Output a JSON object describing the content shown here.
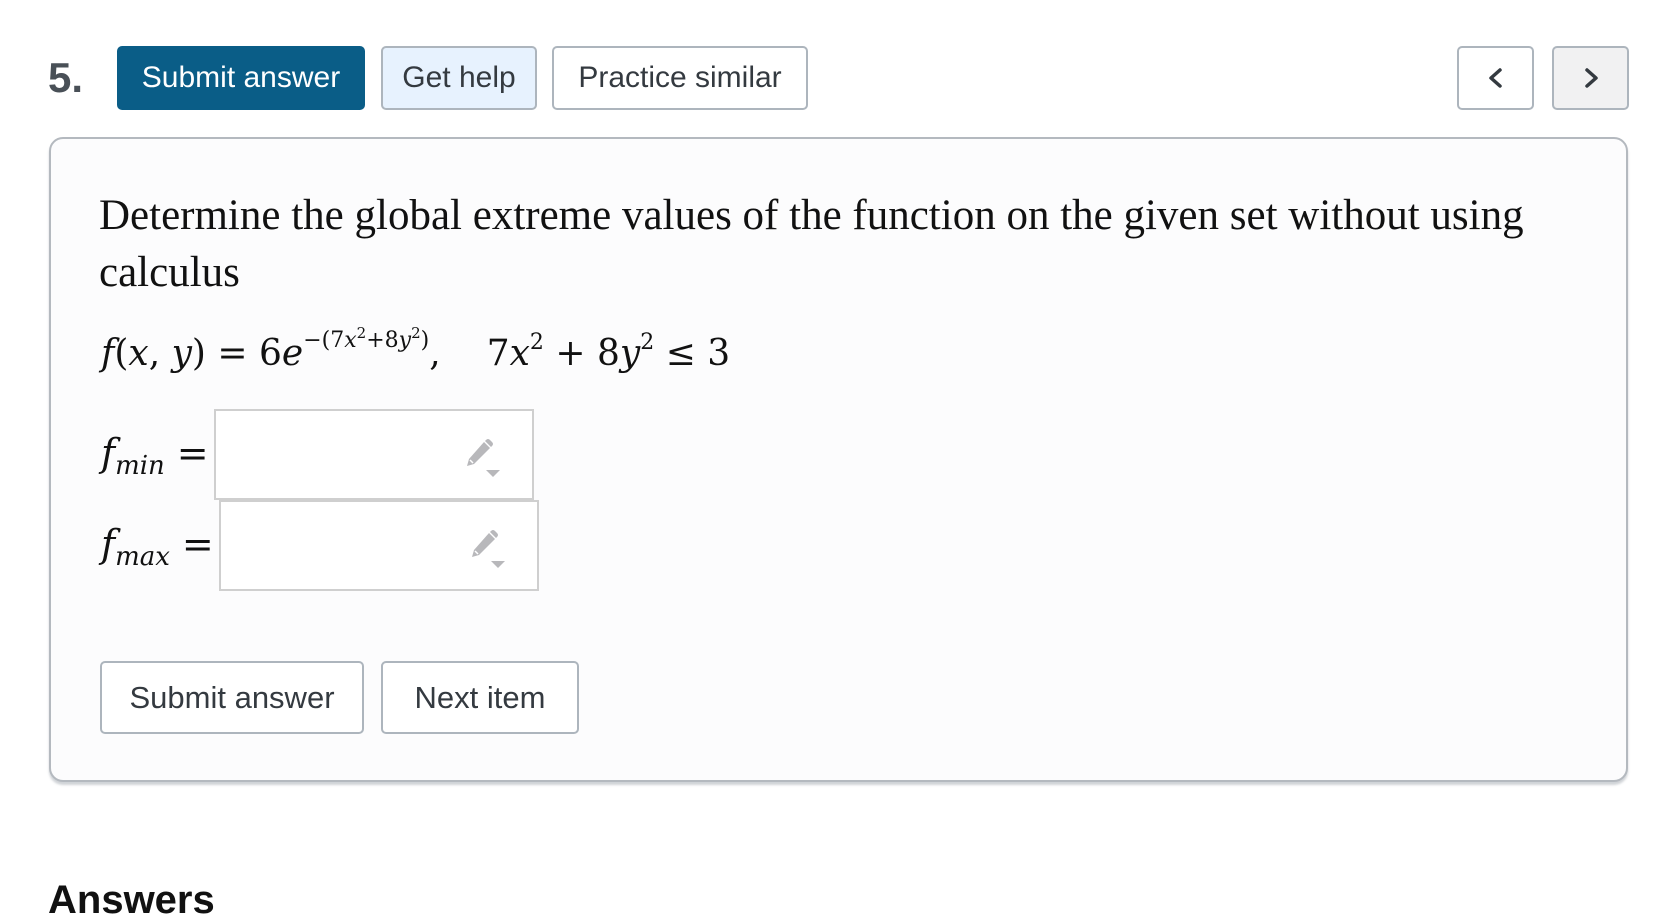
{
  "toolbar": {
    "question_number": "5.",
    "submit_label": "Submit answer",
    "help_label": "Get help",
    "practice_label": "Practice similar",
    "prev_icon": "chevron-left-icon",
    "next_icon": "chevron-right-icon"
  },
  "question": {
    "text": "Determine the global extreme values of the function on the given set without using calculus",
    "function": {
      "lhs": "f(x, y) = 6e",
      "exponent": "−(7x²+8y²)",
      "constraint": "7x² + 8y² ≤ 3"
    }
  },
  "answers": {
    "fmin": {
      "label": "f",
      "sub": "min",
      "value": "",
      "placeholder": ""
    },
    "fmax": {
      "label": "f",
      "sub": "max",
      "value": "",
      "placeholder": ""
    },
    "input_icon": "pencil-dropdown-icon"
  },
  "footer": {
    "submit_label": "Submit answer",
    "next_label": "Next item"
  },
  "answers_heading": "Answers",
  "colors": {
    "primary": "#0a5d87",
    "help_bg": "#e7f2fe",
    "border": "#adb5bd",
    "card_bg": "#fcfcfd"
  }
}
